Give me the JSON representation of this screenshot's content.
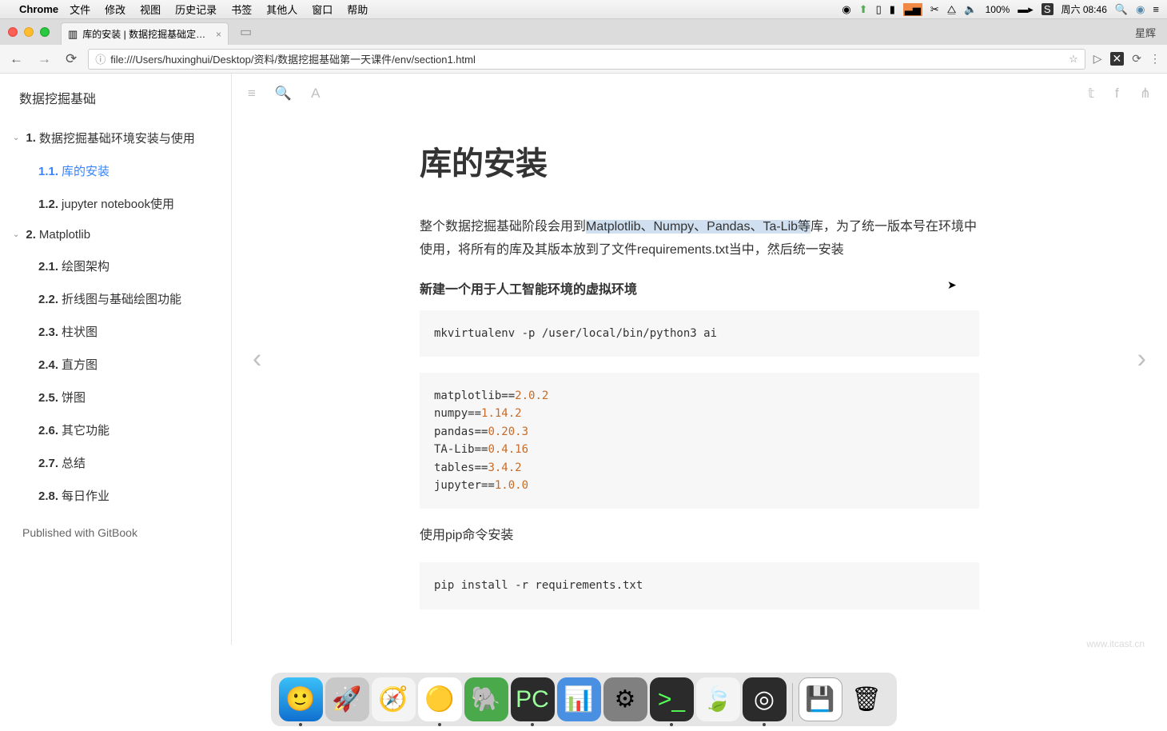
{
  "menubar": {
    "app": "Chrome",
    "menus": [
      "文件",
      "修改",
      "视图",
      "历史记录",
      "书签",
      "其他人",
      "窗口",
      "帮助"
    ],
    "battery": "100%",
    "clock": "周六 08:46"
  },
  "window": {
    "tab_title": "库的安装 | 数据挖掘基础定位、",
    "ext_label": "星辉",
    "url": "file:///Users/huxinghui/Desktop/资料/数据挖掘基础第一天课件/env/section1.html"
  },
  "sidebar": {
    "title": "数据挖掘基础",
    "section1": {
      "num": "1.",
      "label": "数据挖掘基础环境安装与使用"
    },
    "items1": [
      {
        "num": "1.1.",
        "label": "库的安装",
        "active": true
      },
      {
        "num": "1.2.",
        "label": "jupyter notebook使用"
      }
    ],
    "section2": {
      "num": "2.",
      "label": "Matplotlib"
    },
    "items2": [
      {
        "num": "2.1.",
        "label": "绘图架构"
      },
      {
        "num": "2.2.",
        "label": "折线图与基础绘图功能"
      },
      {
        "num": "2.3.",
        "label": "柱状图"
      },
      {
        "num": "2.4.",
        "label": "直方图"
      },
      {
        "num": "2.5.",
        "label": "饼图"
      },
      {
        "num": "2.6.",
        "label": "其它功能"
      },
      {
        "num": "2.7.",
        "label": "总结"
      },
      {
        "num": "2.8.",
        "label": "每日作业"
      }
    ],
    "published": "Published with GitBook"
  },
  "doc": {
    "h1": "库的安装",
    "p1_a": "整个数据挖掘基础阶段会用到",
    "p1_hl": "Matplotlib、Numpy、Pandas、Ta-Lib等",
    "p1_b": "库，为了统一版本号在环境中使用，将所有的库及其版本放到了文件requirements.txt当中，然后统一安装",
    "h4": "新建一个用于人工智能环境的虚拟环境",
    "code1": "mkvirtualenv -p /user/local/bin/python3 ai",
    "pkgs": [
      {
        "name": "matplotlib==",
        "ver": "2.0.2"
      },
      {
        "name": "numpy==",
        "ver": "1.14.2"
      },
      {
        "name": "pandas==",
        "ver": "0.20.3"
      },
      {
        "name": "TA-Lib==",
        "ver": "0.4.16"
      },
      {
        "name": "tables==",
        "ver": "3.4.2"
      },
      {
        "name": "jupyter==",
        "ver": "1.0.0"
      }
    ],
    "p2": "使用pip命令安装",
    "code3": "pip install -r requirements.txt"
  },
  "watermark": "www.itcast.cn"
}
